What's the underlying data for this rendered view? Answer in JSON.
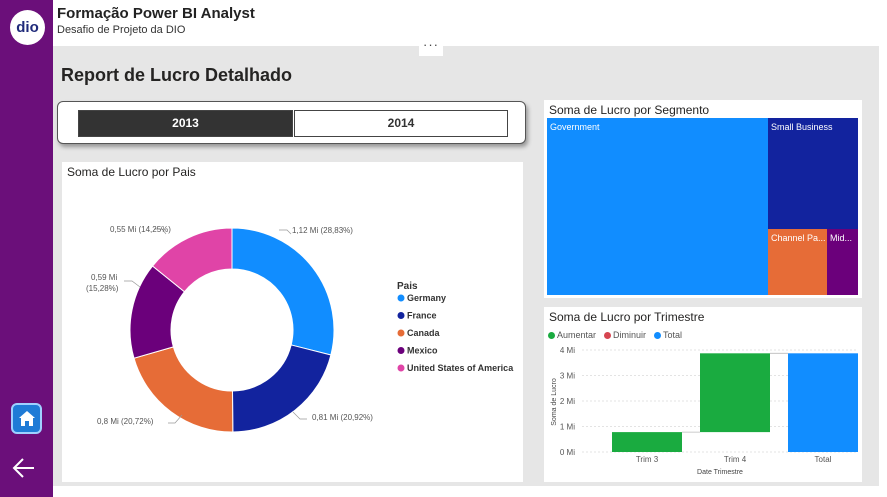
{
  "app": {
    "logo_text": "dio",
    "title": "Formação Power BI Analyst",
    "subtitle": "Desafio de Projeto da DIO"
  },
  "report": {
    "title": "Report de Lucro Detalhado",
    "more_options_label": "···"
  },
  "slicer": {
    "options": [
      {
        "label": "2013",
        "selected": true
      },
      {
        "label": "2014",
        "selected": false
      }
    ]
  },
  "nav": {
    "home_icon": "home-icon",
    "back_icon": "arrow-left-icon"
  },
  "donut": {
    "title": "Soma de Lucro por Pais",
    "legend_title": "Pais",
    "slices": [
      {
        "name": "Germany",
        "value": 1.12,
        "label": "1,12 Mi (28,83%)",
        "color": "#118DFF"
      },
      {
        "name": "France",
        "value": 0.81,
        "label": "0,81 Mi (20,92%)",
        "color": "#12239E"
      },
      {
        "name": "Canada",
        "value": 0.8,
        "label": "0,8 Mi (20,72%)",
        "color": "#E66C37"
      },
      {
        "name": "Mexico",
        "value": 0.59,
        "label_line1": "0,59 Mi",
        "label_line2": "(15,28%)",
        "color": "#6B007B"
      },
      {
        "name": "United States of America",
        "value": 0.55,
        "label": "0,55 Mi (14,25%)",
        "color": "#E044A7"
      }
    ]
  },
  "treemap": {
    "title": "Soma de Lucro por Segmento",
    "tiles": [
      {
        "label": "Government",
        "color": "#118DFF"
      },
      {
        "label": "Small Business",
        "color": "#12239E"
      },
      {
        "label": "Channel Pa...",
        "color": "#E66C37"
      },
      {
        "label": "Mid...",
        "color": "#6B007B"
      }
    ]
  },
  "waterfall": {
    "title": "Soma de Lucro por Trimestre",
    "legend": [
      {
        "label": "Aumentar",
        "color": "#1AAB40"
      },
      {
        "label": "Diminuir",
        "color": "#D64550"
      },
      {
        "label": "Total",
        "color": "#118DFF"
      }
    ]
  },
  "chart_data": {
    "type": "bar",
    "title": "Soma de Lucro por Trimestre",
    "xlabel": "Date Trimestre",
    "ylabel": "Soma de Lucro",
    "categories": [
      "Trim 3",
      "Trim 4",
      "Total"
    ],
    "ylim": [
      0,
      4
    ],
    "yticks": [
      0,
      1,
      2,
      3,
      4
    ],
    "ytick_labels": [
      "0 Mi",
      "1 Mi",
      "2 Mi",
      "3 Mi",
      "4 Mi"
    ],
    "bars": [
      {
        "category": "Trim 3",
        "kind": "Aumentar",
        "start": 0,
        "end": 0.78
      },
      {
        "category": "Trim 4",
        "kind": "Aumentar",
        "start": 0.78,
        "end": 3.87
      },
      {
        "category": "Total",
        "kind": "Total",
        "start": 0,
        "end": 3.87
      }
    ]
  }
}
